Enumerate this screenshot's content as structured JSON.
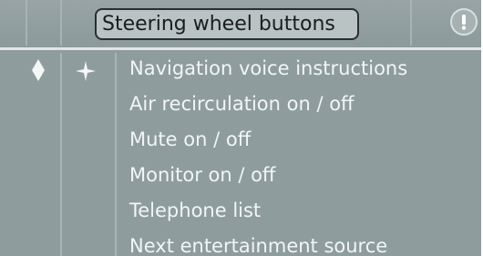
{
  "header": {
    "title": "Steering wheel buttons",
    "info_icon": "info-exclamation-icon"
  },
  "left_icons": [
    "diamond-icon",
    "four-point-star-icon"
  ],
  "menu": {
    "items": [
      {
        "label": "Navigation voice instructions"
      },
      {
        "label": "Air recirculation on / off"
      },
      {
        "label": "Mute on / off"
      },
      {
        "label": "Monitor on / off"
      },
      {
        "label": "Telephone list"
      },
      {
        "label": "Next entertainment source"
      }
    ]
  },
  "colors": {
    "background": "#8e9c9e",
    "menu_text": "#f2f5f5",
    "title_box": "#b9c3c4"
  }
}
